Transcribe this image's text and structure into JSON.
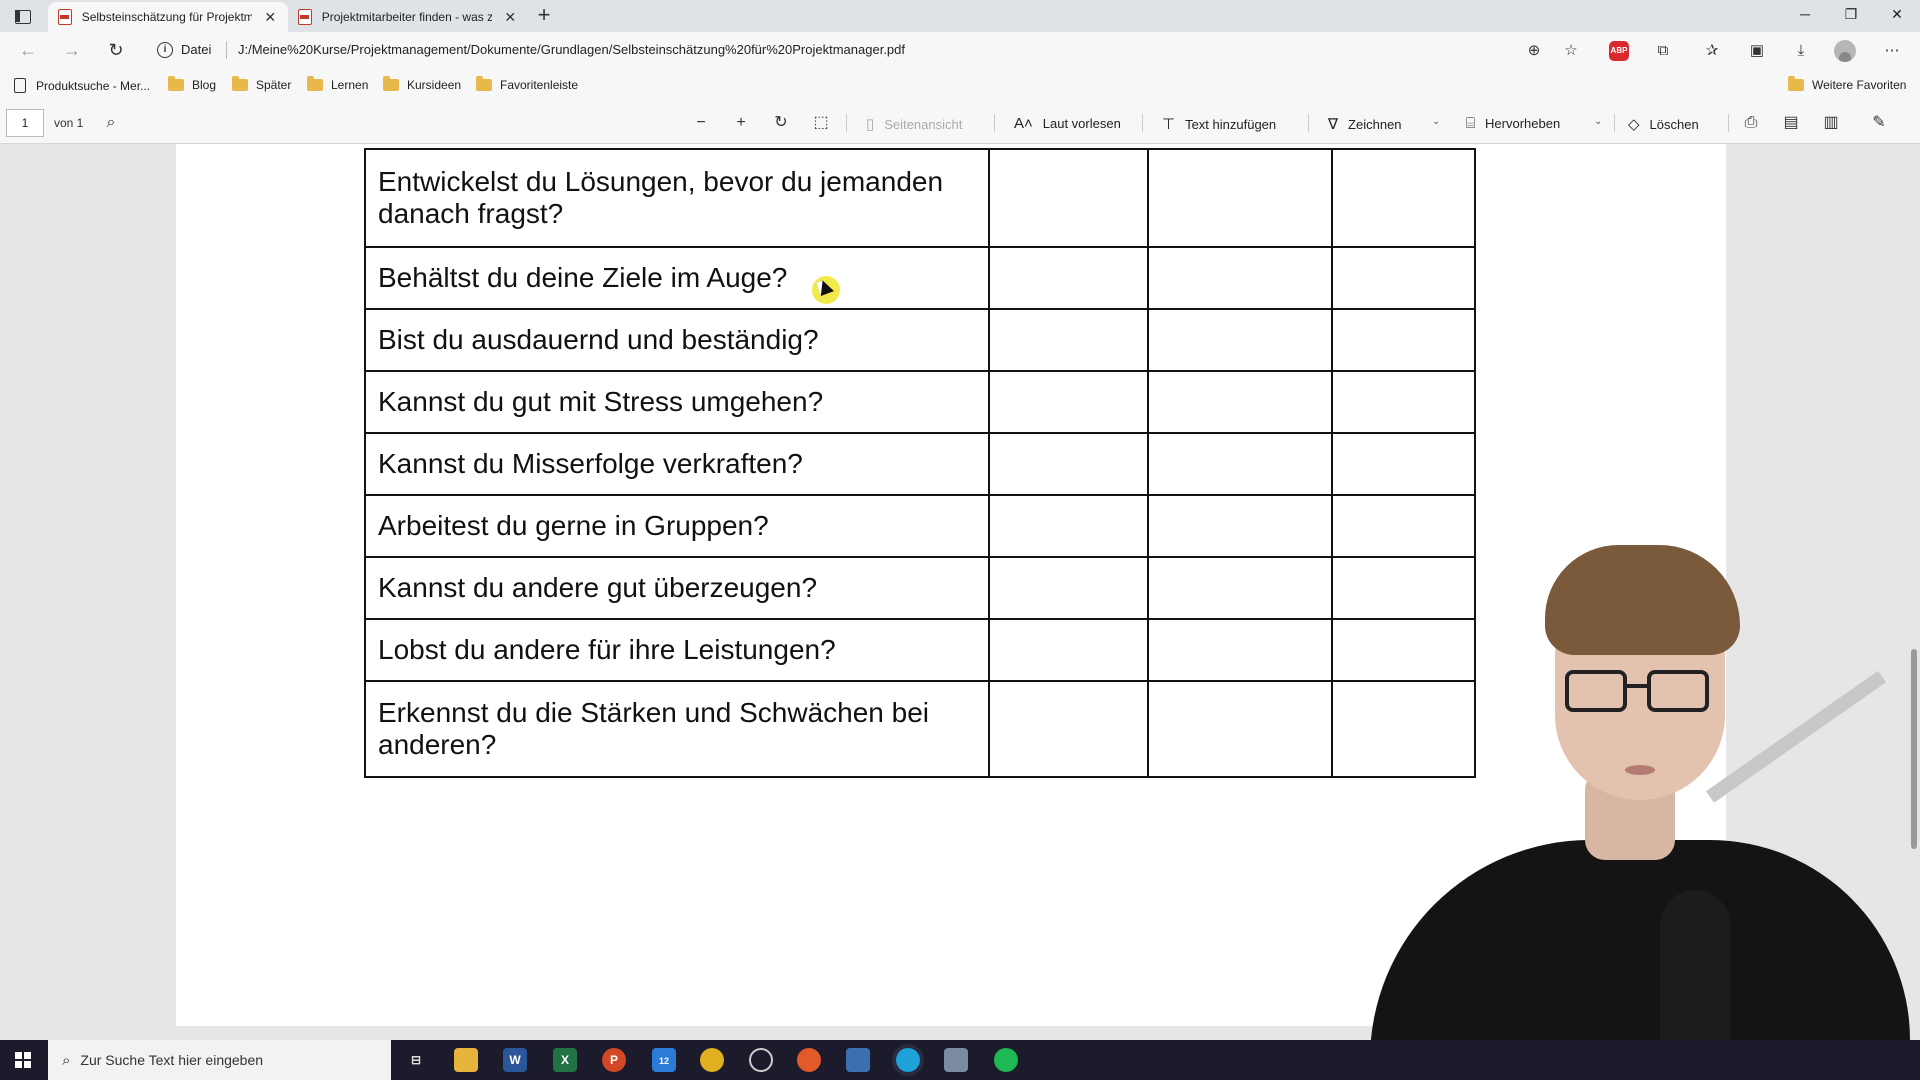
{
  "tabs": [
    {
      "title": "Selbsteinschätzung für Projektmanager",
      "active": true
    },
    {
      "title": "Projektmitarbeiter finden - was zu beachten ist",
      "active": false
    }
  ],
  "address": {
    "protocol_label": "Datei",
    "url": "J:/Meine%20Kurse/Projektmanagement/Dokumente/Grundlagen/Selbsteinschätzung%20für%20Projektmanager.pdf",
    "abp_label": "ABP"
  },
  "bookmarks": {
    "items": [
      "Produktsuche - Mer...",
      "Blog",
      "Später",
      "Lernen",
      "Kursideen",
      "Favoritenleiste"
    ],
    "other": "Weitere Favoriten"
  },
  "pdf_toolbar": {
    "page_number": "1",
    "page_count": "von 1",
    "page_view": "Seitenansicht",
    "read_aloud": "Laut vorlesen",
    "add_text": "Text hinzufügen",
    "draw": "Zeichnen",
    "highlight": "Hervorheben",
    "erase": "Löschen"
  },
  "questions": [
    "Entwickelst du Lösungen, bevor du jemanden danach fragst?",
    "Behältst du deine Ziele im Auge?",
    "Bist du ausdauernd und beständig?",
    "Kannst du gut mit Stress umgehen?",
    "Kannst du Misserfolge verkraften?",
    "Arbeitest du gerne in Gruppen?",
    "Kannst du andere gut überzeugen?",
    "Lobst du andere für ihre Leistungen?",
    "Erkennst du die Stärken und Schwächen bei anderen?"
  ],
  "taskbar": {
    "search_placeholder": "Zur Suche Text hier eingeben",
    "mail_badge": "12"
  }
}
